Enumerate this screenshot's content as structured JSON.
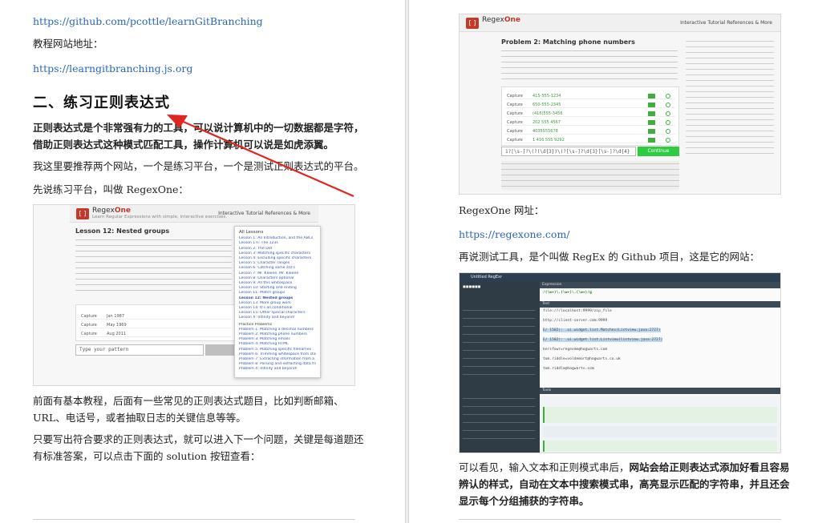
{
  "left_page": {
    "url_github": "https://github.com/pcottle/learnGitBranching",
    "tutorial_label": "教程网站地址：",
    "url_tutorial": "https://learngitbranching.js.org",
    "section_heading": "二、练习正则表达式",
    "intro_line1": "正则表达式是个非常强有力的工具，可以说计算机中的一切数据都是字符，",
    "intro_line2": "借助正则表达式这种模式匹配工具，操作计算机可以说是如虎添翼。",
    "recommend": "我这里要推荐两个网站，一个是练习平台，一个是测试正则表达式的平台。",
    "practice_first": "先说练习平台，叫做 RegexOne：",
    "desc_line1": "前面有基本教程，后面有一些常见的正则表达式题目，比如判断邮箱、",
    "desc_line2": "URL、电话号，或者抽取日志的关键信息等等。",
    "answer_line1": "只要写出符合要求的正则表达式，就可以进入下一个问题，关键是每道题还",
    "answer_line2": "有标准答案，可以点击下面的 solution 按钮查看：",
    "regexone_shot": {
      "brand": "Regex",
      "brand_one": "One",
      "tagline": "Learn Regular Expressions with simple, interactive exercises.",
      "nav": "Interactive Tutorial   References & More",
      "lesson_title": "Lesson 12: Nested groups",
      "table_rows": [
        {
          "task": "Capture",
          "text": "Jan 1987"
        },
        {
          "task": "Capture",
          "text": "May 1969"
        },
        {
          "task": "Capture",
          "text": "Aug 2011"
        }
      ],
      "input_placeholder": "Type your pattern",
      "popup_heading": "All Lessons",
      "lessons": [
        "Lesson 1: An Introduction, and the ABCs",
        "Lesson 1½: The 123s",
        "Lesson 2: The Dot",
        "Lesson 3: Matching specific characters",
        "Lesson 4: Excluding specific characters",
        "Lesson 5: Character ranges",
        "Lesson 6: Catching some zzz's",
        "Lesson 7: Mr. Kleene, Mr. Kleene",
        "Lesson 8: Characters optional",
        "Lesson 9: All this whitespace",
        "Lesson 10: Starting and ending",
        "Lesson 11: Match groups",
        "Lesson 12: Nested groups",
        "Lesson 13: More group work",
        "Lesson 14: It's all conditional",
        "Lesson 15: Other special characters",
        "Lesson X: Infinity and beyond!",
        "Practice Problems",
        "Problem 1: Matching a decimal numbers",
        "Problem 2: Matching phone numbers",
        "Problem 3: Matching emails",
        "Problem 4: Matching HTML",
        "Problem 5: Matching specific filenames",
        "Problem 6: Trimming whitespace from start and end of line",
        "Problem 7: Extracting information from a log file",
        "Problem 8: Parsing and extracting data from a URL",
        "Problem X: Infinity and beyond!"
      ]
    }
  },
  "right_page": {
    "regexone_label": "RegexOne 网址：",
    "url_regexone": "https://regexone.com/",
    "test_tool": "再说测试工具，是个叫做 RegEx 的 Github 项目，这是它的网站：",
    "summary_line1_a": "可以看见，输入文本和正则模式串后，",
    "summary_line1_b": "网站会给正则表达式添加好看且容易",
    "summary_line2": "辨认的样式，自动在文本中搜索模式串，高亮显示匹配的字符串，并且还会",
    "summary_line3": "显示每个分组捕获的字符串。",
    "problem_shot": {
      "brand": "Regex",
      "brand_one": "One",
      "title": "Problem 2: Matching phone numbers",
      "table_rows": [
        {
          "task": "Capture",
          "text": "415-555-1234"
        },
        {
          "task": "Capture",
          "text": "650-555-2345"
        },
        {
          "task": "Capture",
          "text": "(416)555-3456"
        },
        {
          "task": "Capture",
          "text": "202 555 4567"
        },
        {
          "task": "Capture",
          "text": "4035555678"
        },
        {
          "task": "Capture",
          "text": "1 416 555 9292"
        }
      ],
      "pattern": "1?[\\s-]?\\(?(\\d{3})\\)?[\\s-]?\\d{3}[\\s-]?\\d{4}",
      "continue_label": "Continue"
    },
    "regexr_shot": {
      "title": "Untitled RegExr",
      "expression_label": "Expression",
      "expression": "/(\\w+)\\.(\\w+)\\.(\\w+)/g",
      "text_label": "Text",
      "lines": [
        "file:///localhost:9999/zip_file",
        "http://client-server.com:9999",
        "E/ 1582): .ui.widget.list.Matches(Listview.java:2727)",
        "E/ 1582): .ui.widget.list.Listview(listview.java:2727)",
        "kersfowr=regexme@hogwarts.com",
        "tom.riddle=voldemort@hogwarts.co.uk",
        "tom.riddle@hogwarts.com"
      ],
      "tools_label": "Tools"
    }
  }
}
